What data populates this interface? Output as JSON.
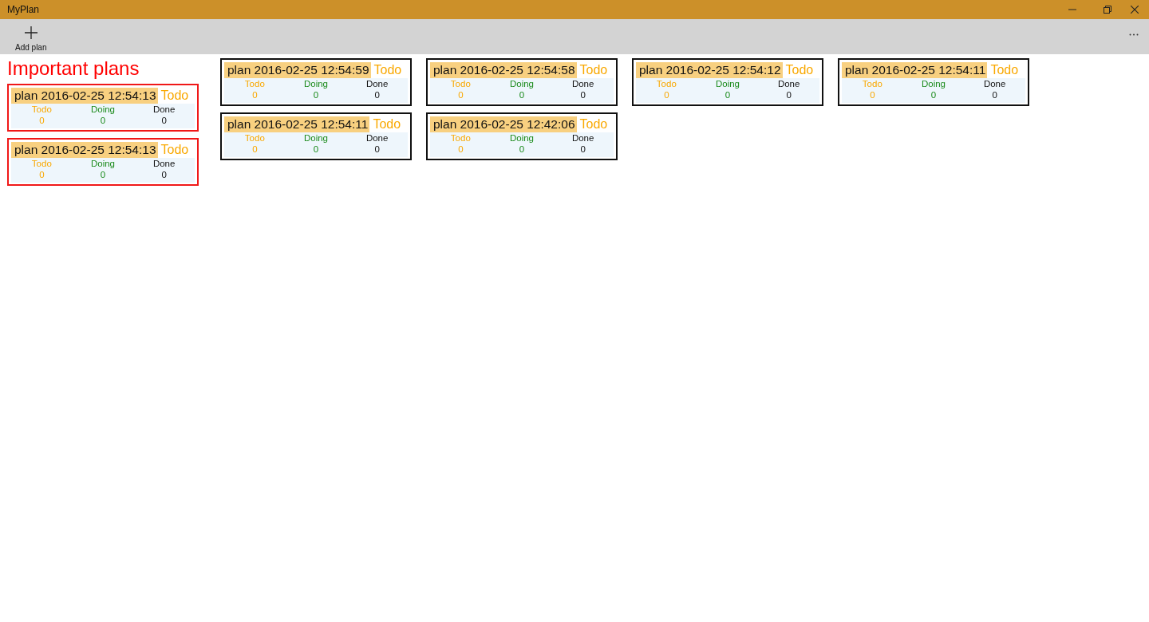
{
  "window": {
    "title": "MyPlan"
  },
  "toolbar": {
    "add_button": "Add plan"
  },
  "important": {
    "title": "Important plans",
    "plans": [
      {
        "name": "plan 2016-02-25 12:54:13",
        "status": "Todo",
        "stats": [
          {
            "kind": "todo",
            "label": "Todo",
            "count": "0"
          },
          {
            "kind": "doing",
            "label": "Doing",
            "count": "0"
          },
          {
            "kind": "done",
            "label": "Done",
            "count": "0"
          }
        ]
      },
      {
        "name": "plan 2016-02-25 12:54:13",
        "status": "Todo",
        "stats": [
          {
            "kind": "todo",
            "label": "Todo",
            "count": "0"
          },
          {
            "kind": "doing",
            "label": "Doing",
            "count": "0"
          },
          {
            "kind": "done",
            "label": "Done",
            "count": "0"
          }
        ]
      }
    ]
  },
  "plans": [
    {
      "name": "plan 2016-02-25 12:54:59",
      "status": "Todo",
      "stats": [
        {
          "kind": "todo",
          "label": "Todo",
          "count": "0"
        },
        {
          "kind": "doing",
          "label": "Doing",
          "count": "0"
        },
        {
          "kind": "done",
          "label": "Done",
          "count": "0"
        }
      ]
    },
    {
      "name": "plan 2016-02-25 12:54:58",
      "status": "Todo",
      "stats": [
        {
          "kind": "todo",
          "label": "Todo",
          "count": "0"
        },
        {
          "kind": "doing",
          "label": "Doing",
          "count": "0"
        },
        {
          "kind": "done",
          "label": "Done",
          "count": "0"
        }
      ]
    },
    {
      "name": "plan 2016-02-25 12:54:12",
      "status": "Todo",
      "stats": [
        {
          "kind": "todo",
          "label": "Todo",
          "count": "0"
        },
        {
          "kind": "doing",
          "label": "Doing",
          "count": "0"
        },
        {
          "kind": "done",
          "label": "Done",
          "count": "0"
        }
      ]
    },
    {
      "name": "plan 2016-02-25 12:54:11",
      "status": "Todo",
      "stats": [
        {
          "kind": "todo",
          "label": "Todo",
          "count": "0"
        },
        {
          "kind": "doing",
          "label": "Doing",
          "count": "0"
        },
        {
          "kind": "done",
          "label": "Done",
          "count": "0"
        }
      ]
    },
    {
      "name": "plan 2016-02-25 12:54:11",
      "status": "Todo",
      "stats": [
        {
          "kind": "todo",
          "label": "Todo",
          "count": "0"
        },
        {
          "kind": "doing",
          "label": "Doing",
          "count": "0"
        },
        {
          "kind": "done",
          "label": "Done",
          "count": "0"
        }
      ]
    },
    {
      "name": "plan 2016-02-25 12:42:06",
      "status": "Todo",
      "stats": [
        {
          "kind": "todo",
          "label": "Todo",
          "count": "0"
        },
        {
          "kind": "doing",
          "label": "Doing",
          "count": "0"
        },
        {
          "kind": "done",
          "label": "Done",
          "count": "0"
        }
      ]
    }
  ]
}
